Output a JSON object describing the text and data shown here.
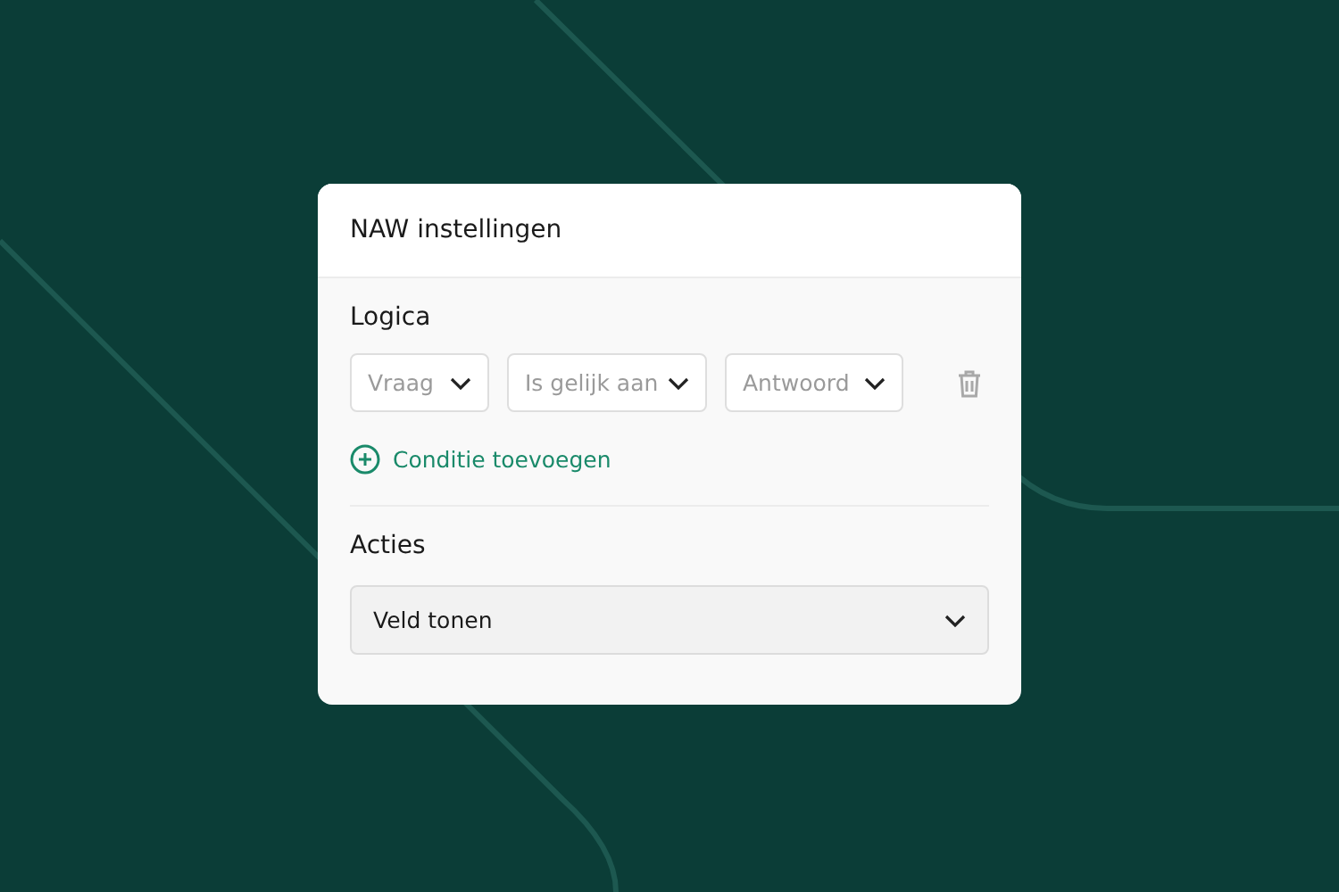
{
  "dialog": {
    "title": "NAW instellingen",
    "logic": {
      "heading": "Logica",
      "conditions": [
        {
          "question": {
            "placeholder": "Vraag"
          },
          "operator": {
            "placeholder": "Is gelijk aan"
          },
          "answer": {
            "placeholder": "Antwoord"
          }
        }
      ],
      "add_label": "Conditie toevoegen"
    },
    "actions": {
      "heading": "Acties",
      "select": {
        "value": "Veld tonen"
      }
    }
  }
}
